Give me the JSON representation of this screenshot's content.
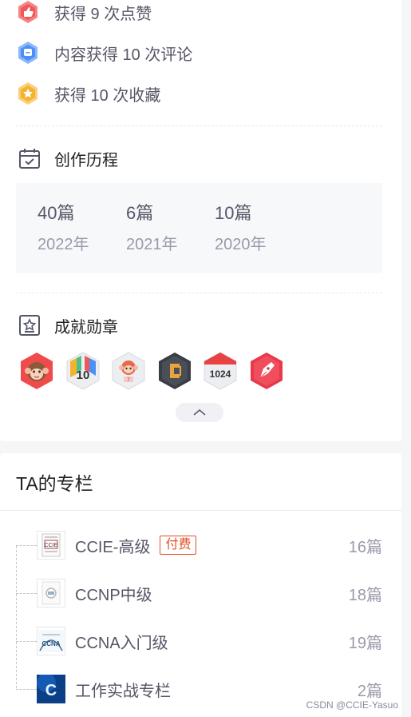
{
  "achievements": [
    {
      "text": "获得 9 次点赞",
      "icon": "thumbs-up-badge-icon",
      "color": "#f0595a"
    },
    {
      "text": "内容获得 10 次评论",
      "icon": "comment-badge-icon",
      "color": "#4c8ff5"
    },
    {
      "text": "获得 10 次收藏",
      "icon": "favorite-badge-icon",
      "color": "#f5b22f"
    }
  ],
  "history": {
    "title": "创作历程",
    "items": [
      {
        "count": "40篇",
        "year": "2022年"
      },
      {
        "count": "6篇",
        "year": "2021年"
      },
      {
        "count": "10篇",
        "year": "2020年"
      }
    ]
  },
  "medals": {
    "title": "成就勋章",
    "items": [
      "monkey-medal-icon",
      "ten-year-medal-icon",
      "monkey-cake-medal-icon",
      "code-medal-icon",
      "1024-medal-icon",
      "pen-medal-icon"
    ],
    "badge_1024_text": "1024",
    "badge_10_text": "10"
  },
  "columns": {
    "title": "TA的专栏",
    "items": [
      {
        "name": "CCIE-高级",
        "paid": "付费",
        "count": "16篇",
        "thumb_text": "CCIE"
      },
      {
        "name": "CCNP中级",
        "paid": "",
        "count": "18篇",
        "thumb_text": ""
      },
      {
        "name": "CCNA入门级",
        "paid": "",
        "count": "19篇",
        "thumb_text": "CCNA"
      },
      {
        "name": "工作实战专栏",
        "paid": "",
        "count": "2篇",
        "thumb_text": "C"
      }
    ]
  },
  "watermark": "CSDN @CCIE-Yasuo"
}
